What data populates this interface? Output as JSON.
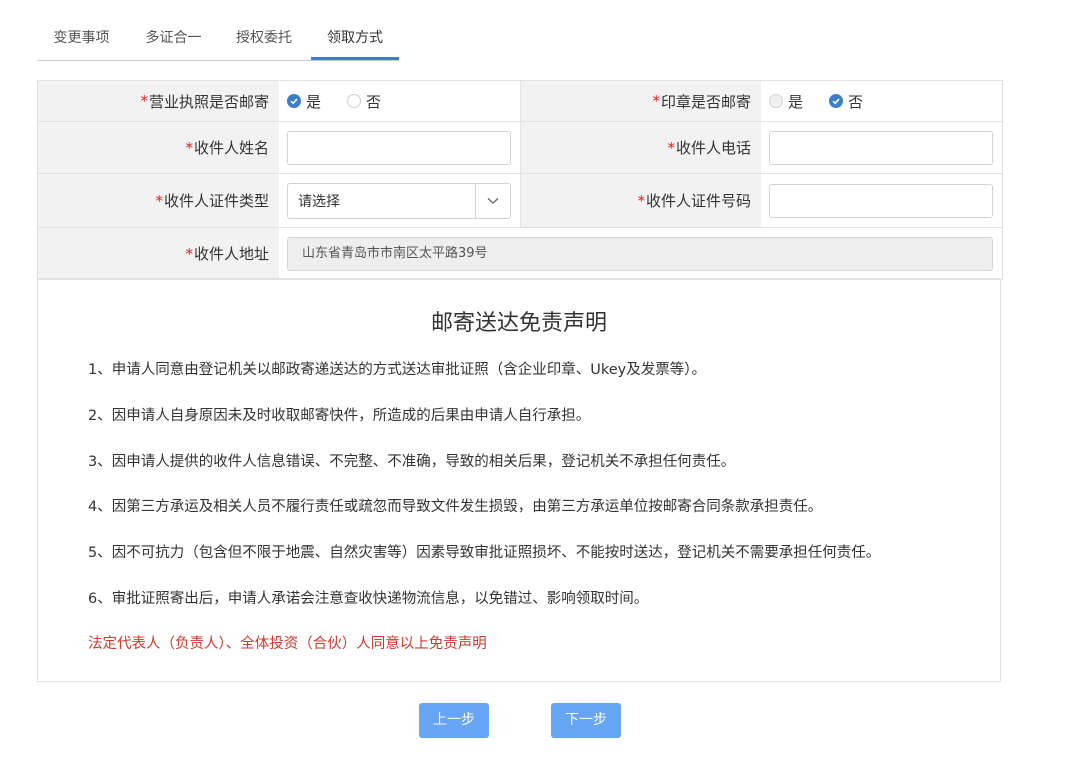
{
  "tabs": [
    {
      "label": "变更事项"
    },
    {
      "label": "多证合一"
    },
    {
      "label": "授权委托"
    },
    {
      "label": "领取方式"
    }
  ],
  "required_mark": "*",
  "form": {
    "license_mail": {
      "label": "营业执照是否邮寄",
      "yes": "是",
      "no": "否",
      "selected": "是"
    },
    "seal_mail": {
      "label": "印章是否邮寄",
      "yes": "是",
      "no": "否",
      "selected": "否"
    },
    "recipient_name": {
      "label": "收件人姓名",
      "value": ""
    },
    "recipient_phone": {
      "label": "收件人电话",
      "value": ""
    },
    "id_type": {
      "label": "收件人证件类型",
      "value": "请选择"
    },
    "id_number": {
      "label": "收件人证件号码",
      "value": ""
    },
    "address": {
      "label": "收件人地址",
      "value": "山东省青岛市市南区太平路39号"
    }
  },
  "disclaimer": {
    "title": "邮寄送达免责声明",
    "items": [
      "1、申请人同意由登记机关以邮政寄递送达的方式送达审批证照（含企业印章、Ukey及发票等）。",
      "2、因申请人自身原因未及时收取邮寄快件，所造成的后果由申请人自行承担。",
      "3、因申请人提供的收件人信息错误、不完整、不准确，导致的相关后果，登记机关不承担任何责任。",
      "4、因第三方承运及相关人员不履行责任或疏忽而导致文件发生损毁，由第三方承运单位按邮寄合同条款承担责任。",
      "5、因不可抗力（包含但不限于地震、自然灾害等）因素导致审批证照损坏、不能按时送达，登记机关不需要承担任何责任。",
      "6、审批证照寄出后，申请人承诺会注意查收快递物流信息，以免错过、影响领取时间。"
    ],
    "consent": "法定代表人（负责人）、全体投资（合伙）人同意以上免责声明"
  },
  "buttons": {
    "prev": "上一步",
    "next": "下一步"
  },
  "colors": {
    "accent": "#3d7ec9",
    "button": "#66a4f4",
    "required": "#e02020",
    "consent": "#d03a2f"
  }
}
